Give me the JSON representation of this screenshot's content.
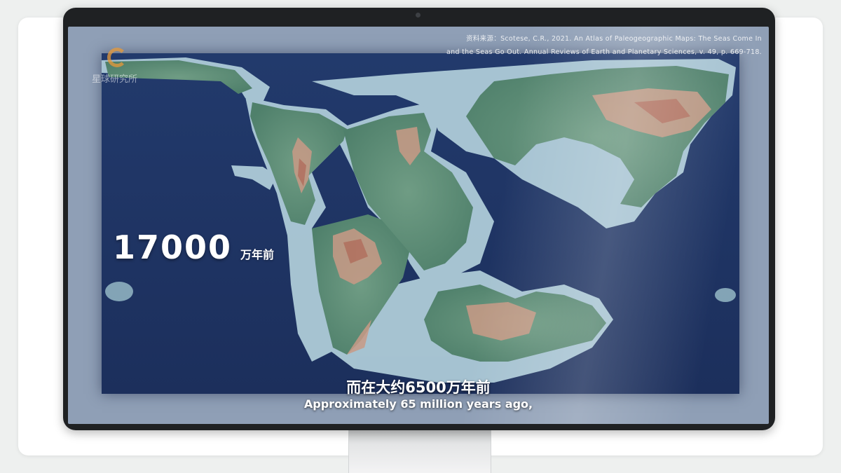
{
  "video": {
    "logo_text": "星球研究所",
    "citation_lines": [
      "资料来源：Scotese, C.R., 2021. An Atlas of Paleogeographic Maps: The Seas Come In",
      "and the Seas Go Out. Annual Reviews of Earth and Planetary Sciences, v. 49, p. 669-718."
    ],
    "age_number": "17000",
    "age_unit": "万年前",
    "subtitle_zh": "而在大约6500万年前",
    "subtitle_en": "Approximately 65 million years ago,"
  },
  "colors": {
    "ocean": "#1f3566",
    "shelf": "#b5d3de",
    "lowland": "#5d917a",
    "highland": "#c99a86",
    "page_background": "#eef0ef",
    "monitor_bezel": "#1f2123"
  }
}
